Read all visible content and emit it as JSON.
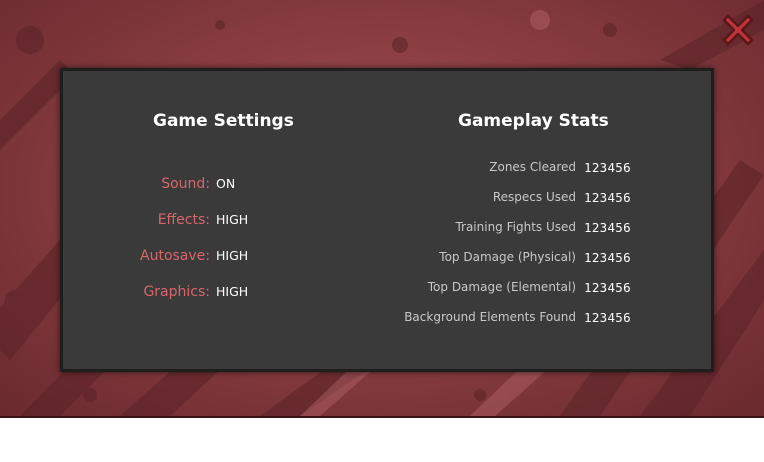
{
  "colors": {
    "frame": "#8a3e42",
    "panel": "#3a3a3a",
    "setting_label": "#d9666b",
    "stat_label": "#c8c8c8",
    "value": "#ffffff",
    "close_icon": "#c0353b"
  },
  "close": {
    "icon": "close-x-icon"
  },
  "settings": {
    "title": "Game Settings",
    "items": [
      {
        "label": "Sound:",
        "value": "ON"
      },
      {
        "label": "Effects:",
        "value": "HIGH"
      },
      {
        "label": "Autosave:",
        "value": "HIGH"
      },
      {
        "label": "Graphics:",
        "value": "HIGH"
      }
    ]
  },
  "stats": {
    "title": "Gameplay Stats",
    "items": [
      {
        "label": "Zones Cleared",
        "value": "123456"
      },
      {
        "label": "Respecs Used",
        "value": "123456"
      },
      {
        "label": "Training Fights Used",
        "value": "123456"
      },
      {
        "label": "Top Damage (Physical)",
        "value": "123456"
      },
      {
        "label": "Top Damage (Elemental)",
        "value": "123456"
      },
      {
        "label": "Background Elements Found",
        "value": "123456"
      }
    ]
  }
}
